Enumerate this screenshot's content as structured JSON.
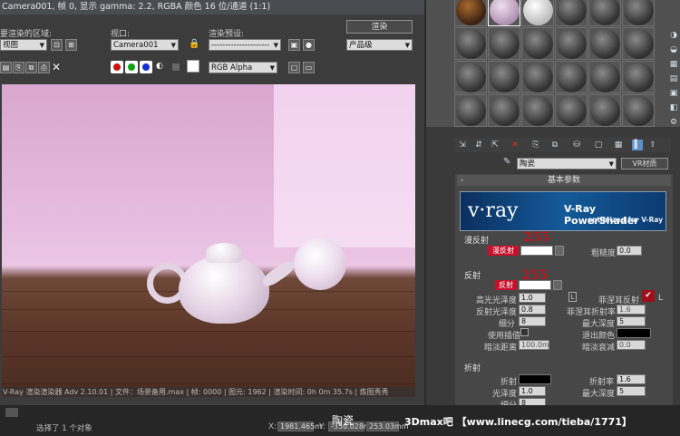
{
  "frame": {
    "title": "Camera001, 帧 0, 显示 gamma: 2.2, RGBA 颜色 16 位/通道 (1:1)",
    "area_label": "要渲染的区域:",
    "area_value": "视图",
    "viewport_label": "视口:",
    "viewport_value": "Camera001",
    "preset_label": "渲染预设:",
    "preset_value": "---------------------",
    "render_button": "渲染",
    "quality_value": "产品级",
    "channel_value": "RGB Alpha",
    "status_line": "V-Ray 渲染渲染器 Adv 2.10.01 | 文件：场景备用.max | 帧: 0000 | 图元: 1962 | 渲染时间: 0h 0m 35.7s | 炼图秀秀"
  },
  "statusbar": {
    "selected": "选择了 1 个对象",
    "x_prefix": "X:",
    "x_value": "1981.465m",
    "y_prefix": "Y:",
    "y_value": "-350.028mm",
    "z_value": "253.03mm",
    "caption": "陶瓷",
    "watermark": "3Dmax吧  【www.linecg.com/tieba/1771】"
  },
  "material": {
    "name": "陶瓷",
    "type_button": "VR材质",
    "basic_params": "基本参数",
    "logo_brand": "v·ray",
    "logo_title": "V-Ray PowerShader",
    "logo_subtitle": "optimized for V-Ray",
    "diffuse_group": "漫反射",
    "diffuse_label": "漫反射",
    "diffuse_value": "255",
    "roughness_label": "粗糙度",
    "roughness_value": "0.0",
    "reflection_group": "反射",
    "reflect_label": "反射",
    "reflect_value": "255",
    "hilight_label": "高光光泽度",
    "hilight_value": "1.0",
    "hilight_l": "L",
    "fresnel_label": "菲涅耳反射",
    "refl_gloss_label": "反射光泽度",
    "refl_gloss_value": "0.8",
    "fresnel_ior_label": "菲涅耳折射率",
    "fresnel_ior_value": "1.6",
    "fresnel_l": "L",
    "subdivs_label": "细分",
    "subdivs_value": "8",
    "max_depth_label": "最大深度",
    "max_depth_value": "5",
    "use_interp_label": "使用插值",
    "exit_color_label": "退出颜色",
    "dim_dist_label": "暗淡距离",
    "dim_dist_value": "100.0m",
    "dim_falloff_label": "暗淡衰减",
    "dim_falloff_value": "0.0",
    "refraction_group": "折射",
    "refract_label": "折射",
    "ior_label": "折射率",
    "ior_value": "1.6",
    "glossiness_label": "光泽度",
    "glossiness_value": "1.0",
    "refr_max_depth_label": "最大深度",
    "refr_max_depth_value": "5",
    "refr_subdivs_label": "细分",
    "refr_subdivs_value": "8"
  },
  "colors": {
    "accent_red": "#c8102e",
    "render_bg": "#dcb3d6",
    "vray_banner": "#0e3d73"
  }
}
